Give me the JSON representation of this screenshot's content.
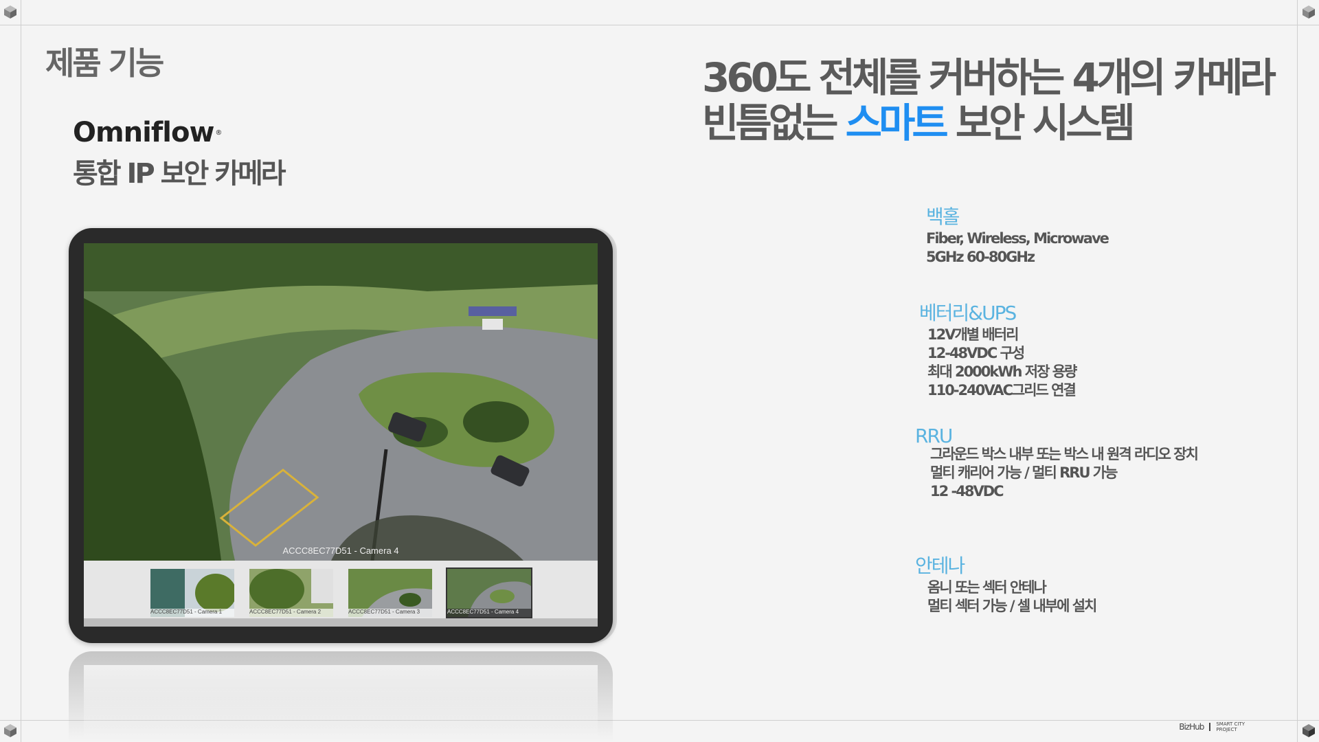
{
  "section_title": "제품 기능",
  "brand": {
    "logo_text": "Omniflow",
    "reg_mark": "®",
    "subtitle": "통합 IP 보안 카메라"
  },
  "headline": {
    "line1": "360도 전체를 커버하는 4개의 카메라",
    "line2_prefix": "빈틈없는 ",
    "line2_accent": "스마트",
    "line2_suffix": " 보안 시스템",
    "accent_color": "#1f8ef1"
  },
  "camera_view": {
    "main_caption": "ACCC8EC77D51 - Camera 4",
    "thumbnails": [
      {
        "label": "ACCC8EC77D51 - Camera 1",
        "active": false
      },
      {
        "label": "ACCC8EC77D51 - Camera 2",
        "active": false
      },
      {
        "label": "ACCC8EC77D51 - Camera 3",
        "active": false
      },
      {
        "label": "ACCC8EC77D51 - Camera 4",
        "active": true
      }
    ]
  },
  "features": [
    {
      "title": "백홀",
      "lines": [
        "Fiber, Wireless, Microwave",
        "5GHz 60-80GHz"
      ]
    },
    {
      "title": "베터리&UPS",
      "lines": [
        "12V개별 배터리",
        "12-48VDC 구성",
        "최대 2000kWh 저장 용량",
        "110-240VAC그리드 연결"
      ]
    },
    {
      "title": "RRU",
      "lines": [
        "그라운드 박스 내부 또는 박스 내 원격 라디오 장치",
        "멀티 캐리어 가능 / 멀티 RRU 가능",
        "12 -48VDC"
      ]
    },
    {
      "title": "안테나",
      "lines": [
        "옴니 또는 섹터 안테나",
        "멀티 섹터 가능 / 셀 내부에 설치"
      ]
    }
  ],
  "footer": {
    "brand": "BizHub",
    "project_line1": "SMART CITY",
    "project_line2": "PROJECT"
  },
  "icons": {
    "corner": "cube-icon"
  }
}
